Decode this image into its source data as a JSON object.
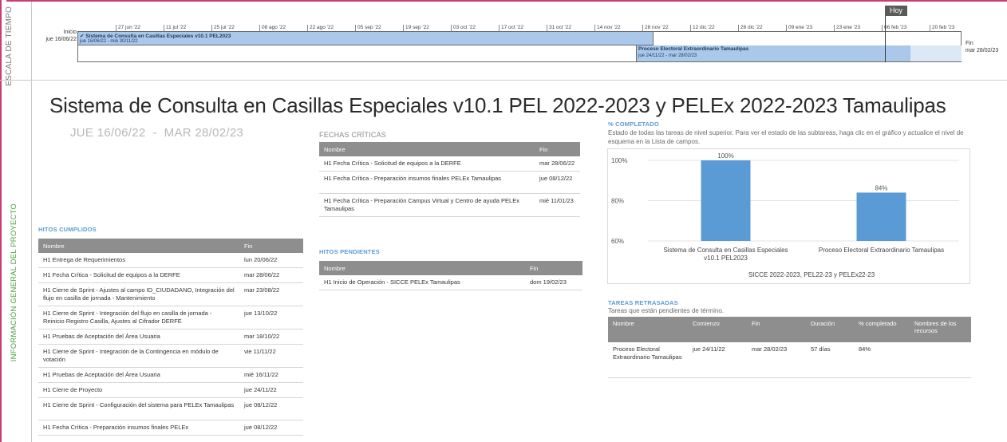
{
  "sidebar": {
    "timescale_label": "ESCALA DE TIEMPO",
    "overview_label": "INFORMACIÓN GENERAL DEL PROYECTO"
  },
  "timeline": {
    "start_label": "Inicio",
    "start_date": "jue 16/06/22",
    "end_label": "Fin",
    "end_date": "mar 28/02/23",
    "today_label": "Hoy",
    "ticks": [
      "27 jun '22",
      "11 jul '22",
      "25 jul '22",
      "08 ago '22",
      "22 ago '22",
      "05 sep '22",
      "19 sep '22",
      "03 oct '22",
      "17 oct '22",
      "31 oct '22",
      "14 nov '22",
      "28 nov '22",
      "12 dic '22",
      "26 dic '22",
      "09 ene '23",
      "23 ene '23",
      "06 feb '23",
      "20 feb '23"
    ],
    "bars": [
      {
        "name": "Sistema de Consulta en Casillas Especiales v10.1 PEL2023",
        "dates": "jue 16/06/22 - mié 30/11/22"
      },
      {
        "name": "Proceso Electoral Extraordinario Tamaulipas",
        "dates": "jue 24/11/22 - mar 28/02/23"
      }
    ]
  },
  "title": "Sistema de Consulta en Casillas Especiales v10.1 PEL 2022-2023 y PELEx 2022-2023 Tamaulipas",
  "date_range": {
    "start": "JUE 16/06/22",
    "sep": "-",
    "end": "MAR 28/02/23"
  },
  "critical_dates": {
    "title": "FECHAS CRÍTICAS",
    "headers": [
      "Nombre",
      "Fin"
    ],
    "rows": [
      [
        "H1 Fecha Crítica - Solicitud de equipos a la DERFE",
        "mar 28/06/22"
      ],
      [
        "H1 Fecha Crítica - Preparación insumos finales PELEx Tamaulipas",
        "jue 08/12/22"
      ],
      [
        "H1 Fecha Crítica - Preparación Campus Virtual y Centro de ayuda PELEx Tamaulipas",
        "mié 11/01/23"
      ]
    ]
  },
  "milestones_done": {
    "title": "HITOS CUMPLIDOS",
    "headers": [
      "Nombre",
      "Fin"
    ],
    "rows": [
      [
        "H1 Entrega de Requerimientos",
        "lun 20/06/22"
      ],
      [
        "H1 Fecha Crítica - Solicitud de equipos a la DERFE",
        "mar 28/06/22"
      ],
      [
        "H1 Cierre de Sprint - Ajustes al campo ID_CIUDADANO, Integración del flujo en casilla de jornada - Mantenimiento",
        "mar 23/08/22"
      ],
      [
        "H1 Cierre de Sprint - Integración del flujo en casilla de jornada - Reinicio Registro Casilla, Ajustes al Cifrador DERFE",
        "jue 13/10/22"
      ],
      [
        "H1 Pruebas de Aceptación del Área Usuaria",
        "mar 18/10/22"
      ],
      [
        "H1 Cierre de Sprint - Integración de la Contingencia en módulo de votación",
        "vie 11/11/22"
      ],
      [
        "H1 Pruebas de Aceptación del Área Usuaria",
        "mié 16/11/22"
      ],
      [
        "H1 Cierre de Proyecto",
        "jue 24/11/22"
      ],
      [
        "H1 Cierre de Sprint - Configuración del sistema para PELEx Tamaulipas",
        "jue 08/12/22"
      ],
      [
        "H1 Fecha Crítica - Preparación insumos finales PELEx",
        "jue 08/12/22"
      ]
    ]
  },
  "milestones_pending": {
    "title": "HITOS PENDIENTES",
    "headers": [
      "Nombre",
      "Fin"
    ],
    "rows": [
      [
        "H1 Inicio de Operación - SICCE PELEx Tamaulipas",
        "dom 19/02/23"
      ]
    ]
  },
  "percent_complete": {
    "title": "% COMPLETADO",
    "description": "Estado de todas las tareas de nivel superior. Para ver el estado de las subtareas, haga clic en el gráfico y actualice el nivel de esquema en la Lista de campos."
  },
  "chart_data": {
    "type": "bar",
    "categories": [
      "Sistema de Consulta en Casillas Especiales v10.1 PEL2023",
      "Proceso Electoral Extraordinario Tamaulipas"
    ],
    "values": [
      100,
      84
    ],
    "value_labels": [
      "100%",
      "84%"
    ],
    "title": "",
    "xlabel": "SICCE 2022-2023, PEL22-23 y PELEx22-23",
    "ylabel": "",
    "ylim": [
      60,
      100
    ],
    "yticks": [
      "100%",
      "80%",
      "60%"
    ],
    "grid": true,
    "color": "#5b9bd5"
  },
  "late_tasks": {
    "title": "TAREAS RETRASADAS",
    "description": "Tareas que están pendientes de término.",
    "headers": [
      "Nombre",
      "Comienzo",
      "Fin",
      "Duración",
      "% completado",
      "Nombres de los recursos"
    ],
    "rows": [
      [
        "Proceso Electoral Extraordinario Tamaulipas",
        "jue 24/11/22",
        "mar 28/02/23",
        "57 días",
        "84%",
        ""
      ]
    ]
  }
}
